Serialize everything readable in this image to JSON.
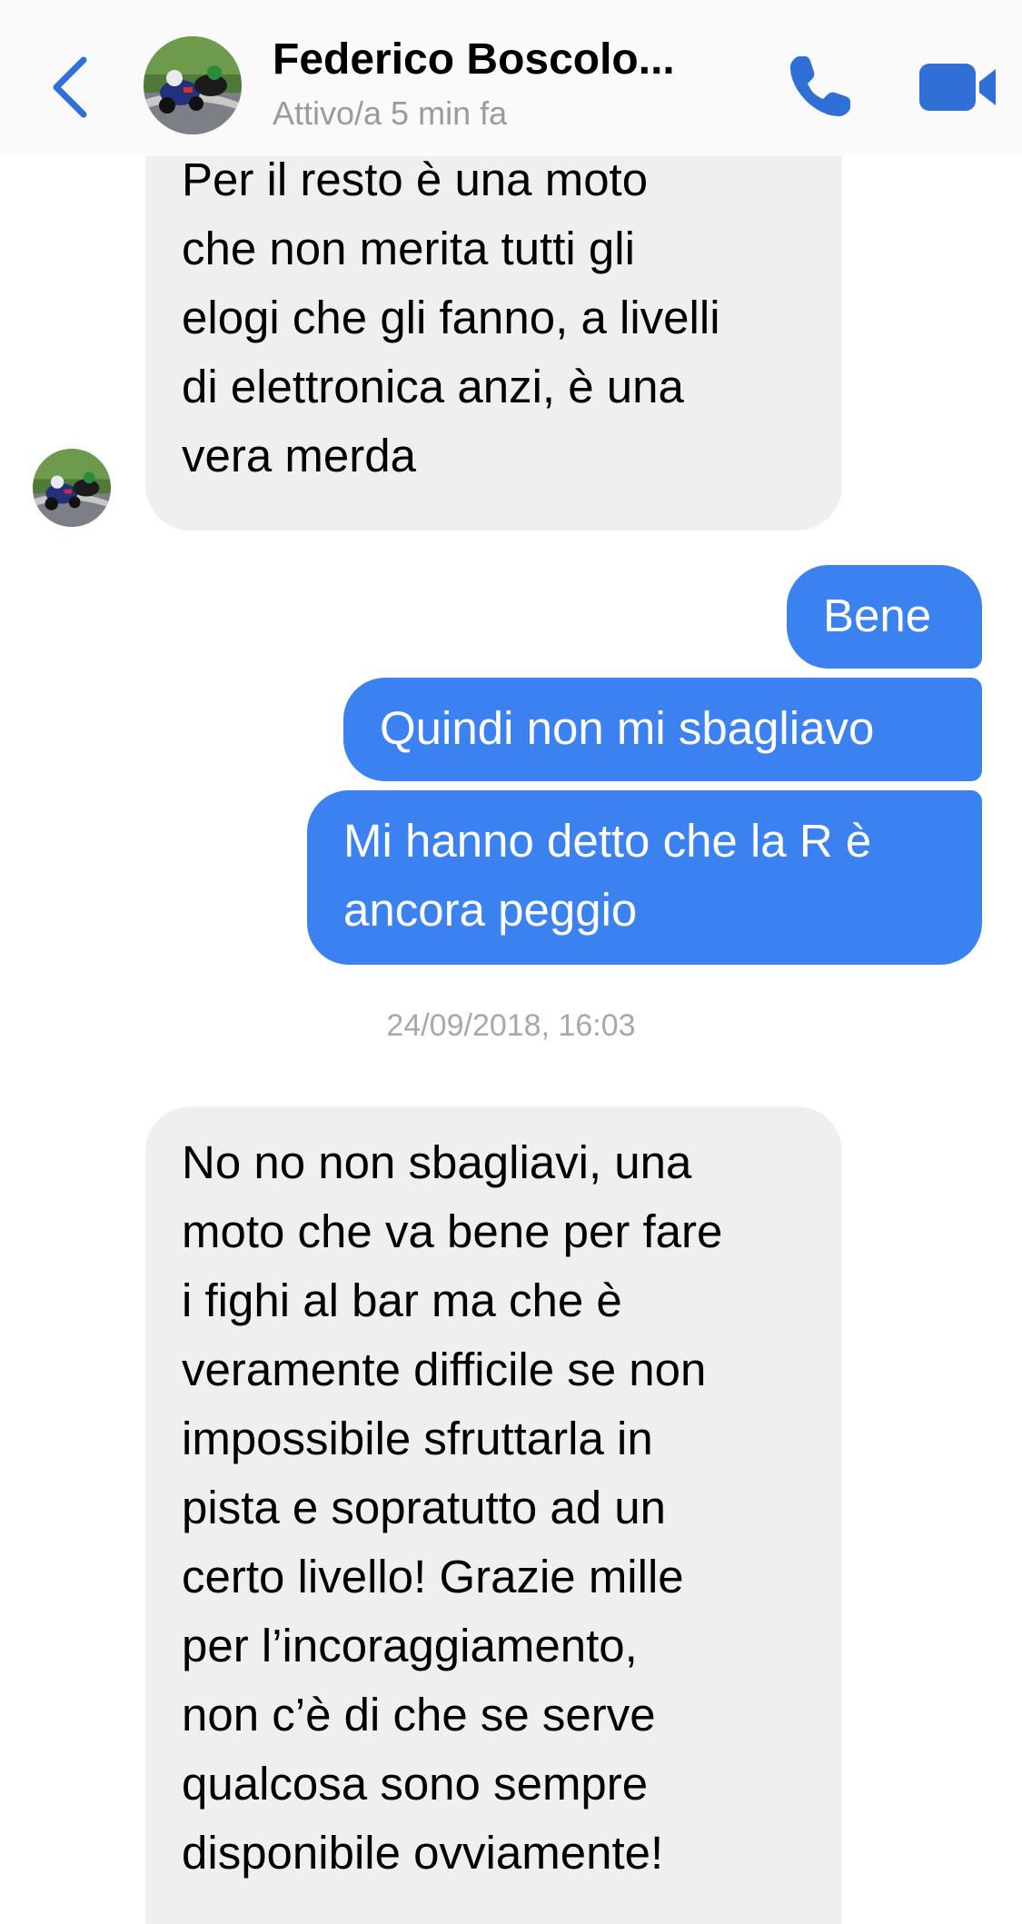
{
  "header": {
    "contact_name": "Federico Boscolo...",
    "status": "Attivo/a 5 min fa",
    "back_icon": "chevron-left-icon",
    "call_icon": "phone-icon",
    "video_icon": "video-camera-icon",
    "accent_color": "#2f6fd6"
  },
  "messages": [
    {
      "direction": "incoming",
      "text": "Per il resto è una moto\nche non merita tutti gli\nelogi che gli fanno, a livelli\ndi elettronica anzi, è una\nvera merda"
    },
    {
      "direction": "outgoing",
      "text": "Bene"
    },
    {
      "direction": "outgoing",
      "text": "Quindi non mi sbagliavo"
    },
    {
      "direction": "outgoing",
      "text": "Mi hanno detto che la R è\nancora peggio"
    },
    {
      "direction": "incoming",
      "text": "No no non sbagliavi, una\nmoto che va bene per fare\ni fighi al bar ma che è\nveramente difficile se non\nimpossibile sfruttarla in\npista e sopratutto ad un\ncerto livello! Grazie mille\nper l’incoraggiamento,\nnon c’è di che se serve\nqualcosa sono sempre\ndisponibile ovviamente!"
    }
  ],
  "timestamp": "24/09/2018, 16:03",
  "colors": {
    "incoming_bubble": "#efefef",
    "outgoing_bubble": "#3b82f0",
    "timestamp_text": "#a8a8a8",
    "status_text": "#9b9b9b"
  }
}
